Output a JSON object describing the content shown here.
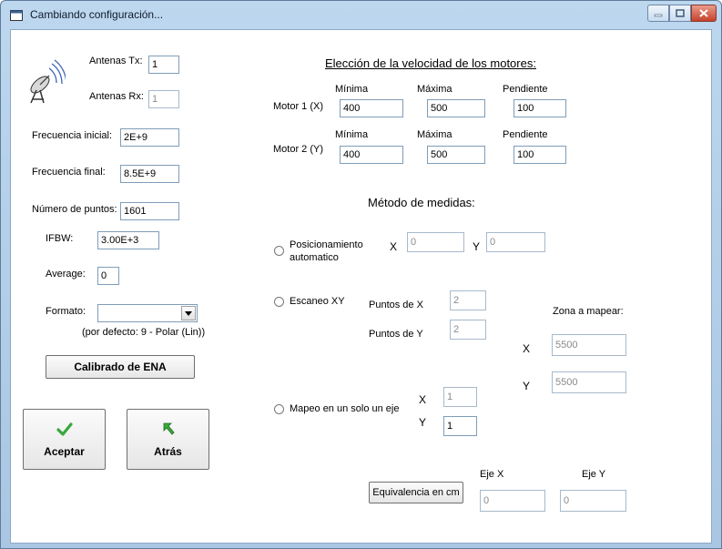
{
  "window": {
    "title": "Cambiando configuración..."
  },
  "antenas": {
    "tx_label": "Antenas Tx:",
    "tx_value": "1",
    "rx_label": "Antenas Rx:",
    "rx_value": "1"
  },
  "frecuencia": {
    "inicial_label": "Frecuencia inicial:",
    "inicial_value": "2E+9",
    "final_label": "Frecuencia final:",
    "final_value": "8.5E+9"
  },
  "puntos": {
    "label": "Número de puntos:",
    "value": "1601"
  },
  "ifbw": {
    "label": "IFBW:",
    "value": "3.00E+3"
  },
  "average": {
    "label": "Average:",
    "value": "0"
  },
  "formato": {
    "label": "Formato:",
    "value": "",
    "hint": "(por defecto: 9 - Polar (Lin))"
  },
  "calibrado_button": "Calibrado de ENA",
  "aceptar_button": "Aceptar",
  "atras_button": "Atrás",
  "velocidad": {
    "heading": "Elección de la velocidad de los motores:",
    "minima_label": "Mínima",
    "maxima_label": "Máxima",
    "pendiente_label": "Pendiente",
    "motor1_label": "Motor 1 (X)",
    "motor1": {
      "minima": "400",
      "maxima": "500",
      "pendiente": "100"
    },
    "motor2_label": "Motor 2 (Y)",
    "motor2": {
      "minima": "400",
      "maxima": "500",
      "pendiente": "100"
    }
  },
  "metodo": {
    "heading": "Método de medidas:",
    "posicionamiento": {
      "label_line1": "Posicionamiento",
      "label_line2": "automatico",
      "x_label": "X",
      "x_value": "0",
      "y_label": "Y",
      "y_value": "0"
    },
    "escaneo": {
      "label": "Escaneo XY",
      "puntos_x_label": "Puntos de X",
      "puntos_x_value": "2",
      "puntos_y_label": "Puntos de Y",
      "puntos_y_value": "2",
      "zona_label": "Zona a mapear:",
      "zona_x_label": "X",
      "zona_x_value": "5500",
      "zona_y_label": "Y",
      "zona_y_value": "5500"
    },
    "mapeo": {
      "label": "Mapeo en un solo un eje",
      "x_label": "X",
      "x_value": "1",
      "y_label": "Y",
      "y_value": "1"
    }
  },
  "equivalencia": {
    "button": "Equivalencia en cm",
    "eje_x_label": "Eje X",
    "eje_x_value": "0",
    "eje_y_label": "Eje Y",
    "eje_y_value": "0"
  }
}
